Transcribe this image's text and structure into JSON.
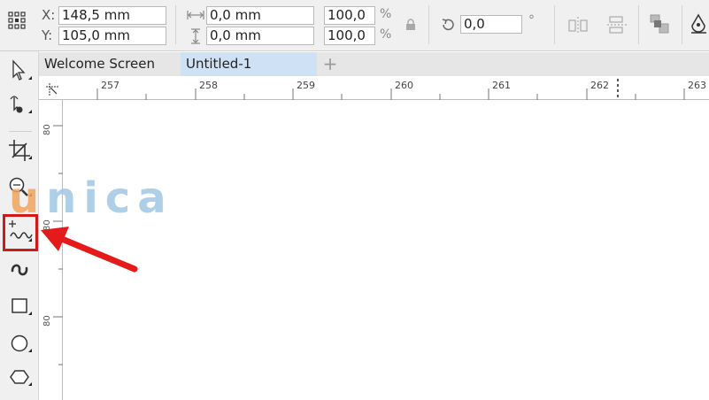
{
  "property_bar": {
    "x_label": "X:",
    "x_value": "148,5 mm",
    "y_label": "Y:",
    "y_value": "105,0 mm",
    "width_value": "0,0 mm",
    "height_value": "0,0 mm",
    "scale_x": "100,0",
    "scale_y": "100,0",
    "percent_symbol": "%",
    "rotation_value": "0,0",
    "degree_symbol": "°"
  },
  "tabs": [
    {
      "label": "Welcome Screen",
      "active": false
    },
    {
      "label": "Untitled-1",
      "active": true
    }
  ],
  "tab_add": "+",
  "ruler": {
    "top_ticks": [
      "257",
      "258",
      "259",
      "260",
      "261",
      "262",
      "263"
    ],
    "left_ticks": [
      "80",
      "80",
      "80"
    ]
  },
  "toolbox": {
    "tools": [
      "pick-tool",
      "shape-tool",
      "crop-tool",
      "zoom-tool",
      "freehand-tool",
      "artistic-media-tool",
      "rectangle-tool",
      "ellipse-tool",
      "polygon-tool"
    ],
    "highlighted_tool": "freehand-tool"
  },
  "watermark": {
    "text_first": "u",
    "text_rest": "nica"
  },
  "colors": {
    "highlight": "#d01a1a",
    "active_tab": "#cfe2f5",
    "watermark_blue": "#9fc8e4",
    "watermark_orange": "#f2a65e"
  }
}
